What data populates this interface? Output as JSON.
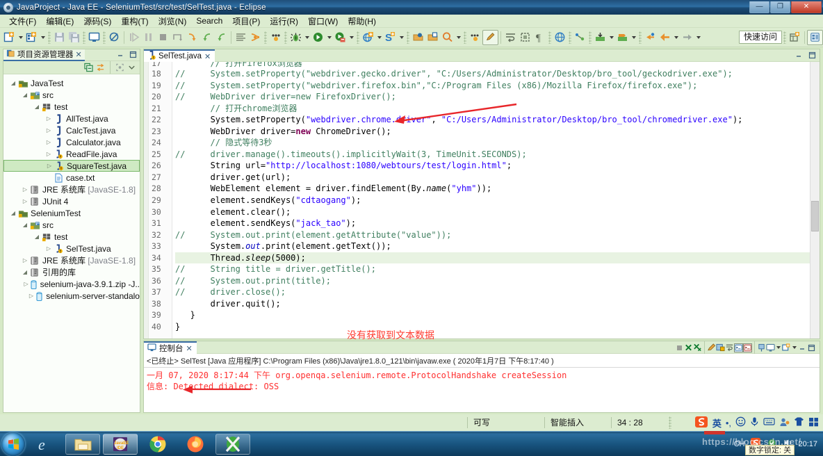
{
  "window": {
    "title": "JavaProject - Java EE - SeleniumTest/src/test/SelTest.java - Eclipse",
    "minimize_label": "—",
    "maximize_label": "❐",
    "close_label": "✕"
  },
  "menubar": {
    "items": [
      {
        "label": "文件(F)",
        "name": "menu-file"
      },
      {
        "label": "编辑(E)",
        "name": "menu-edit"
      },
      {
        "label": "源码(S)",
        "name": "menu-source"
      },
      {
        "label": "重构(T)",
        "name": "menu-refactor"
      },
      {
        "label": "浏览(N)",
        "name": "menu-navigate"
      },
      {
        "label": "Search",
        "name": "menu-search"
      },
      {
        "label": "项目(P)",
        "name": "menu-project"
      },
      {
        "label": "运行(R)",
        "name": "menu-run"
      },
      {
        "label": "窗口(W)",
        "name": "menu-window"
      },
      {
        "label": "帮助(H)",
        "name": "menu-help"
      }
    ]
  },
  "toolbar": {
    "quick_access_label": "快速访问",
    "icons": [
      "new-wizard-icon",
      "new-dropdown-arrow",
      "new-java-project-icon",
      "new-java-dropdown-arrow",
      "save-icon",
      "save-all-icon",
      "open-console-icon",
      "skip-breakpoints-icon",
      "resume-icon",
      "suspend-icon",
      "terminate-icon",
      "step-over-icon",
      "step-into-icon",
      "step-return-icon",
      "step-out-icon",
      "toggle-ansi-icon",
      "toggle-mark-occurrences-icon",
      "coverage-icon",
      "debug-icon",
      "debug-dropdown-arrow",
      "run-icon",
      "run-dropdown-arrow",
      "run-last-tool-icon",
      "run-tool-dropdown-arrow",
      "new-web-icon",
      "new-web-dropdown-arrow",
      "new-server-icon",
      "new-server-dropdown-arrow",
      "open-type-icon",
      "open-task-icon",
      "search-icon",
      "search-dropdown-arrow",
      "profile-icon",
      "edit-pencil-icon",
      "toggle-word-wrap-icon",
      "toggle-block-select-icon",
      "show-whitespace-icon",
      "open-web-browser-icon",
      "link-icon",
      "export-icon",
      "export-dropdown-arrow",
      "import-icon",
      "import-dropdown-arrow",
      "back-icon",
      "back-prev-icon",
      "back-dropdown-arrow",
      "forward-icon",
      "forward-dropdown-arrow"
    ],
    "perspective_new_label": "",
    "perspective_javaee_label": ""
  },
  "explorer": {
    "tab_label": "项目资源管理器",
    "tab_close": "✕",
    "toolbar_icons": [
      "collapse-all-icon",
      "link-with-editor-icon",
      "focus-on-active-task-icon",
      "view-menu-chevron-icon"
    ],
    "panel_minimize": "—",
    "panel_maximize": "❐",
    "tree": [
      {
        "label": "JavaTest",
        "indent": 0,
        "twisty": "open",
        "icon": "java-project-icon",
        "selected": false
      },
      {
        "label": "src",
        "indent": 1,
        "twisty": "open",
        "icon": "source-folder-icon",
        "selected": false
      },
      {
        "label": "test",
        "indent": 2,
        "twisty": "open",
        "icon": "package-icon",
        "selected": false
      },
      {
        "label": "AllTest.java",
        "indent": 3,
        "twisty": "closed",
        "icon": "java-file-icon",
        "selected": false
      },
      {
        "label": "CalcTest.java",
        "indent": 3,
        "twisty": "closed",
        "icon": "java-file-icon",
        "selected": false
      },
      {
        "label": "Calculator.java",
        "indent": 3,
        "twisty": "closed",
        "icon": "java-file-icon",
        "selected": false
      },
      {
        "label": "ReadFile.java",
        "indent": 3,
        "twisty": "closed",
        "icon": "java-class-warn-icon",
        "selected": false
      },
      {
        "label": "SquareTest.java",
        "indent": 3,
        "twisty": "closed",
        "icon": "java-class-warn-icon",
        "selected": true
      },
      {
        "label": "case.txt",
        "indent": 3,
        "twisty": "none",
        "icon": "text-file-icon",
        "selected": false
      },
      {
        "label": "JRE 系统库",
        "suffix": " [JavaSE-1.8]",
        "indent": 1,
        "twisty": "closed",
        "icon": "library-icon",
        "selected": false
      },
      {
        "label": "JUnit 4",
        "indent": 1,
        "twisty": "closed",
        "icon": "library-icon",
        "selected": false
      },
      {
        "label": "SeleniumTest",
        "indent": 0,
        "twisty": "open",
        "icon": "java-project-icon",
        "selected": false
      },
      {
        "label": "src",
        "indent": 1,
        "twisty": "open",
        "icon": "source-folder-icon",
        "selected": false
      },
      {
        "label": "test",
        "indent": 2,
        "twisty": "open",
        "icon": "package-icon",
        "selected": false
      },
      {
        "label": "SelTest.java",
        "indent": 3,
        "twisty": "closed",
        "icon": "java-class-warn-icon",
        "selected": false
      },
      {
        "label": "JRE 系统库",
        "suffix": " [JavaSE-1.8]",
        "indent": 1,
        "twisty": "closed",
        "icon": "library-icon",
        "selected": false
      },
      {
        "label": "引用的库",
        "indent": 1,
        "twisty": "open",
        "icon": "library-icon",
        "selected": false
      },
      {
        "label": "selenium-java-3.9.1.zip -J..",
        "indent": 2,
        "twisty": "closed",
        "icon": "jar-icon",
        "selected": false
      },
      {
        "label": "selenium-server-standalo",
        "indent": 2,
        "twisty": "closed",
        "icon": "jar-icon",
        "selected": false
      }
    ]
  },
  "editor": {
    "tab_label": "SelTest.java",
    "tab_close": "✕",
    "tab_icon": "java-class-warn-icon",
    "panel_minimize": "—",
    "panel_maximize": "❐",
    "first_line_number": 17,
    "current_line": 34,
    "annotation": "没有获取到文本数据",
    "lines": [
      {
        "n": 17,
        "text": "       // 打开Firefox浏览器",
        "clipped": true
      },
      {
        "n": 18,
        "text": "//     System.setProperty(\"webdriver.gecko.driver\", \"C:/Users/Administrator/Desktop/bro_tool/geckodriver.exe\");"
      },
      {
        "n": 19,
        "text": "//     System.setProperty(\"webdriver.firefox.bin\",\"C:/Program Files (x86)/Mozilla Firefox/firefox.exe\");"
      },
      {
        "n": 20,
        "text": "//     WebDriver driver=new FirefoxDriver();"
      },
      {
        "n": 21,
        "text": "       // 打开chrome浏览器"
      },
      {
        "n": 22,
        "text": "       System.setProperty(\"webdriver.chrome.driver\", \"C:/Users/Administrator/Desktop/bro_tool/chromedriver.exe\");"
      },
      {
        "n": 23,
        "text": "       WebDriver driver=new ChromeDriver();"
      },
      {
        "n": 24,
        "text": "       // 隐式等待3秒"
      },
      {
        "n": 25,
        "text": "//     driver.manage().timeouts().implicitlyWait(3, TimeUnit.SECONDS);"
      },
      {
        "n": 26,
        "text": "       String url=\"http://localhost:1080/webtours/test/login.html\";"
      },
      {
        "n": 27,
        "text": "       driver.get(url);"
      },
      {
        "n": 28,
        "text": "       WebElement element = driver.findElement(By.name(\"yhm\"));"
      },
      {
        "n": 29,
        "text": "       element.sendKeys(\"cdtaogang\");"
      },
      {
        "n": 30,
        "text": "       element.clear();"
      },
      {
        "n": 31,
        "text": "       element.sendKeys(\"jack_tao\");"
      },
      {
        "n": 32,
        "text": "//     System.out.print(element.getAttribute(\"value\"));"
      },
      {
        "n": 33,
        "text": "       System.out.print(element.getText());"
      },
      {
        "n": 34,
        "text": "       Thread.sleep(5000);"
      },
      {
        "n": 35,
        "text": "//     String title = driver.getTitle();"
      },
      {
        "n": 36,
        "text": "//     System.out.print(title);"
      },
      {
        "n": 37,
        "text": "//     driver.close();"
      },
      {
        "n": 38,
        "text": "       driver.quit();"
      },
      {
        "n": 39,
        "text": "   }"
      },
      {
        "n": 40,
        "text": "}"
      }
    ]
  },
  "console": {
    "tab_label": "控制台",
    "tab_close": "✕",
    "tab_icon": "console-icon",
    "header": "<已终止> SelTest [Java 应用程序] C:\\Program Files (x86)\\Java\\jre1.8.0_121\\bin\\javaw.exe ( 2020年1月7日 下午8:17:40 )",
    "output_line1": "一月 07, 2020 8:17:44 下午 org.openqa.selenium.remote.ProtocolHandshake createSession",
    "output_line2": "信息: Detected dialect: OSS",
    "toolbar_icons": [
      "terminate-icon",
      "remove-launch-icon",
      "remove-all-launches-icon",
      "clear-console-icon",
      "scroll-lock-icon",
      "word-wrap-icon",
      "show-console-on-output-icon",
      "show-console-on-error-icon",
      "pin-console-icon",
      "display-selected-console-icon",
      "display-console-dropdown-arrow",
      "open-console-icon",
      "open-console-dropdown-arrow"
    ],
    "panel_minimize": "—",
    "panel_maximize": "❐",
    "text_color": "#ff2f2f"
  },
  "statusbar": {
    "writable": "可写",
    "insert_mode": "智能插入",
    "cursor_position": "34 : 28",
    "ime_label": "英",
    "tray_icons": [
      "sogou-logo-icon",
      "ime-mode-icon",
      "ime-punctuation-icon",
      "emoji-icon",
      "voice-input-icon",
      "soft-keyboard-icon",
      "user-icon",
      "skin-icon",
      "toolbox-icon"
    ]
  },
  "taskbar": {
    "start_label": "",
    "items": [
      {
        "name": "taskbar-start-orb",
        "icon": "windows-logo-icon"
      },
      {
        "name": "taskbar-ie",
        "icon": "internet-explorer-icon"
      },
      {
        "name": "taskbar-explorer",
        "icon": "file-explorer-icon"
      },
      {
        "name": "taskbar-eclipse",
        "icon": "eclipse-javaee-icon"
      },
      {
        "name": "taskbar-chrome",
        "icon": "chrome-icon"
      },
      {
        "name": "taskbar-firefox",
        "icon": "firefox-icon"
      },
      {
        "name": "taskbar-xmind",
        "icon": "xmind-icon"
      }
    ],
    "ime_indicator": "CH",
    "clock_time": "20:17",
    "numlock_tip": "数字锁定: 关",
    "watermark": "https://blog.csdn.net/"
  },
  "colors": {
    "accent": "#3a6ea5",
    "panel_bg": "#dcecd0",
    "selection": "#cfeac3",
    "annotation_red": "#ff3b30",
    "console_red": "#ff2f2f",
    "string_blue": "#2a00ff",
    "comment_green": "#3f7f5f",
    "keyword_purple": "#7f0055"
  }
}
